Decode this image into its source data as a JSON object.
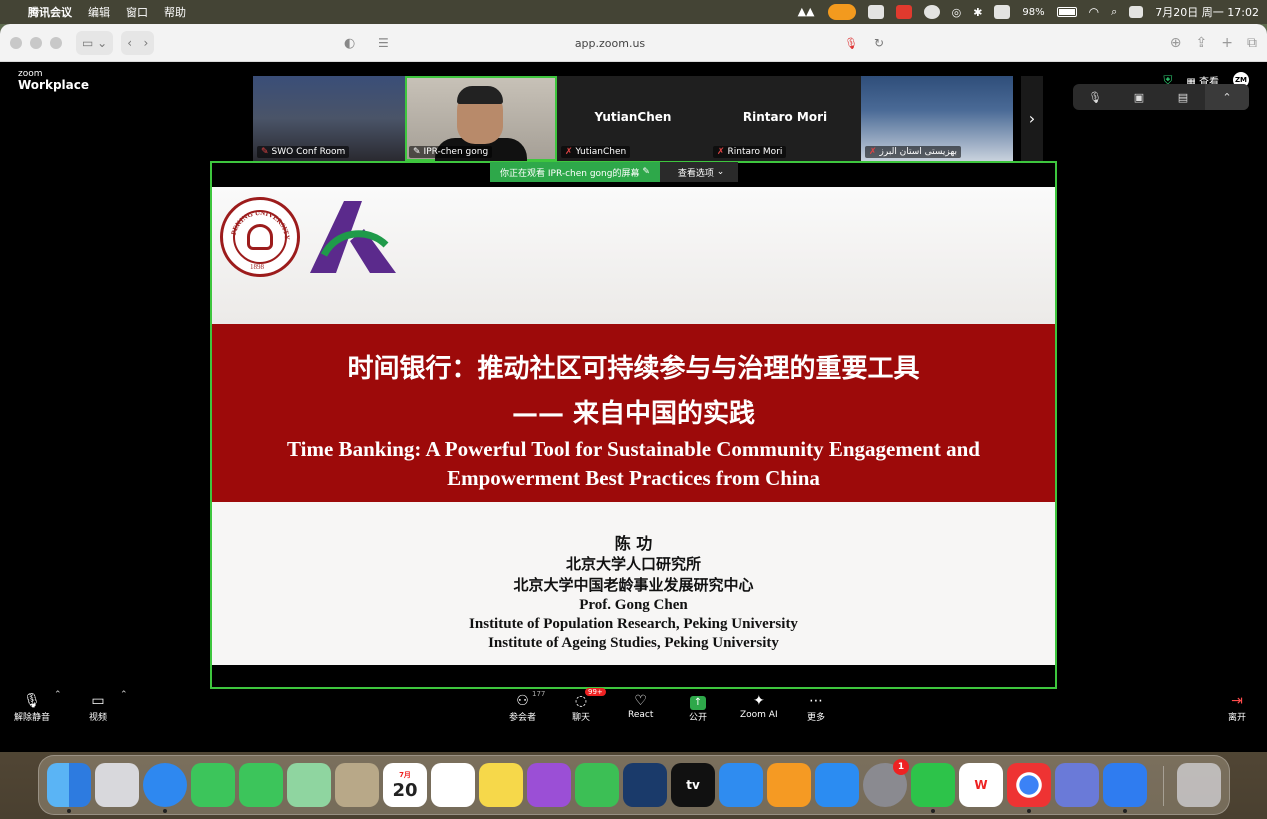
{
  "menubar": {
    "apple_icon": "apple-logo",
    "app_name": "腾讯会议",
    "menus": [
      "编辑",
      "窗口",
      "帮助"
    ],
    "battery": "98%",
    "datetime": "7月20日 周一 17:02"
  },
  "browser": {
    "url": "app.zoom.us"
  },
  "zoom": {
    "brand_small": "zoom",
    "brand_large": "Workplace",
    "view_label": "查看",
    "avatar_initials": "ZM",
    "gallery": [
      {
        "name": "SWO Conf Room",
        "kind": "video"
      },
      {
        "name": "IPR-chen gong",
        "kind": "video"
      },
      {
        "name": "YutianChen",
        "big": "YutianChen",
        "kind": "name"
      },
      {
        "name": "Rintaro Mori",
        "big": "Rintaro Mori",
        "kind": "name"
      },
      {
        "name": "بهزیستی استان البرز",
        "kind": "video"
      }
    ],
    "share_banner": "你正在观看 IPR-chen gong的屏幕",
    "view_options": "查看选项",
    "toolbar": {
      "unmute": "解除静音",
      "video": "视频",
      "participants": "参会者",
      "participants_count": "177",
      "chat": "聊天",
      "chat_badge": "99+",
      "react": "React",
      "share": "公开",
      "zoom_ai": "Zoom AI",
      "more": "更多",
      "leave": "离开"
    }
  },
  "slide": {
    "title_cn_1": "时间银行：推动社区可持续参与与治理的重要工具",
    "title_cn_2": "—— 来自中国的实践",
    "title_en_1": "Time Banking: A Powerful Tool for Sustainable Community Engagement and",
    "title_en_2": "Empowerment Best Practices from China",
    "author_cn": "陈 功",
    "affil_cn_1": "北京大学人口研究所",
    "affil_cn_2": "北京大学中国老龄事业发展研究中心",
    "author_en": "Prof. Gong Chen",
    "affil_en_1": "Institute of Population Research, Peking University",
    "affil_en_2": "Institute of Ageing Studies, Peking University",
    "seal_year": "1898",
    "seal_text": "PEKING UNIVERSITY"
  },
  "dock": {
    "calendar_day": "20",
    "calendar_month": "7月",
    "settings_badge": "1",
    "tv_label": "tv"
  },
  "colors": {
    "slide_red": "#9d0a0a",
    "active_green": "#3ec63e",
    "leave_red": "#ff4b4b"
  }
}
